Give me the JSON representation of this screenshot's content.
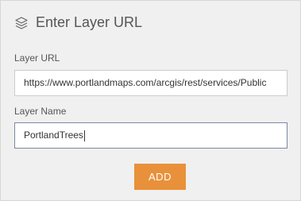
{
  "header": {
    "title": "Enter Layer URL",
    "icon": "layers-icon"
  },
  "form": {
    "url_label": "Layer URL",
    "url_value": "https://www.portlandmaps.com/arcgis/rest/services/Public",
    "name_label": "Layer Name",
    "name_value": "PortlandTrees"
  },
  "actions": {
    "add_label": "ADD"
  },
  "colors": {
    "accent": "#e8913a",
    "panel_background": "#f0f0f0",
    "text": "#555555"
  }
}
